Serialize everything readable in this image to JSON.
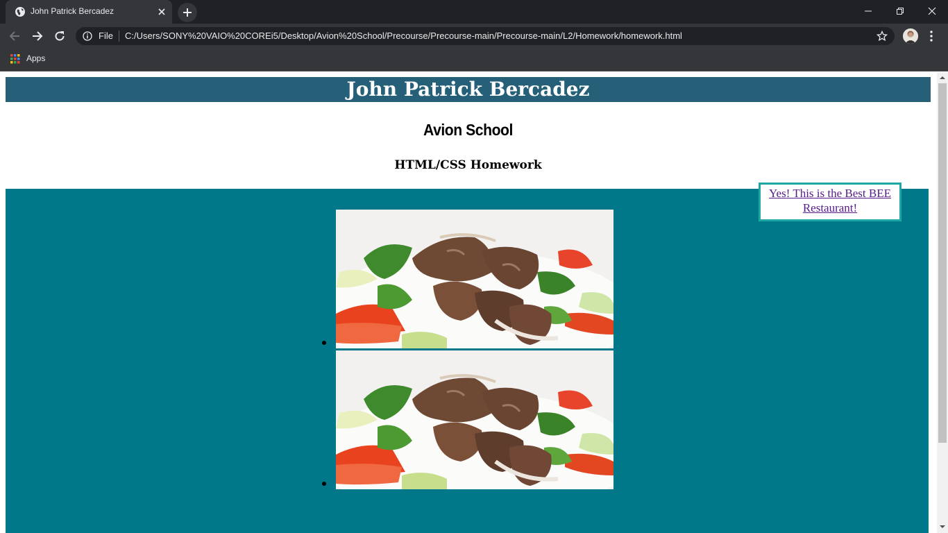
{
  "browser": {
    "tab_title": "John Patrick Bercadez",
    "scheme_label": "File",
    "url": "C:/Users/SONY%20VAIO%20COREi5/Desktop/Avion%20School/Precourse/Precourse-main/Precourse-main/L2/Homework/homework.html",
    "bookmark_apps_label": "Apps"
  },
  "page": {
    "title": "John Patrick Bercadez",
    "school": "Avion School",
    "subtitle": "HTML/CSS Homework",
    "bee_link": "Yes! This is the Best BEE Restaurant!",
    "food_items": [
      "beef-salad-image",
      "beef-salad-image"
    ]
  },
  "colors": {
    "header_bg": "#255f78",
    "content_bg": "#00788a",
    "link_box_border": "#1fa7a6",
    "link_color": "#551a8b"
  }
}
